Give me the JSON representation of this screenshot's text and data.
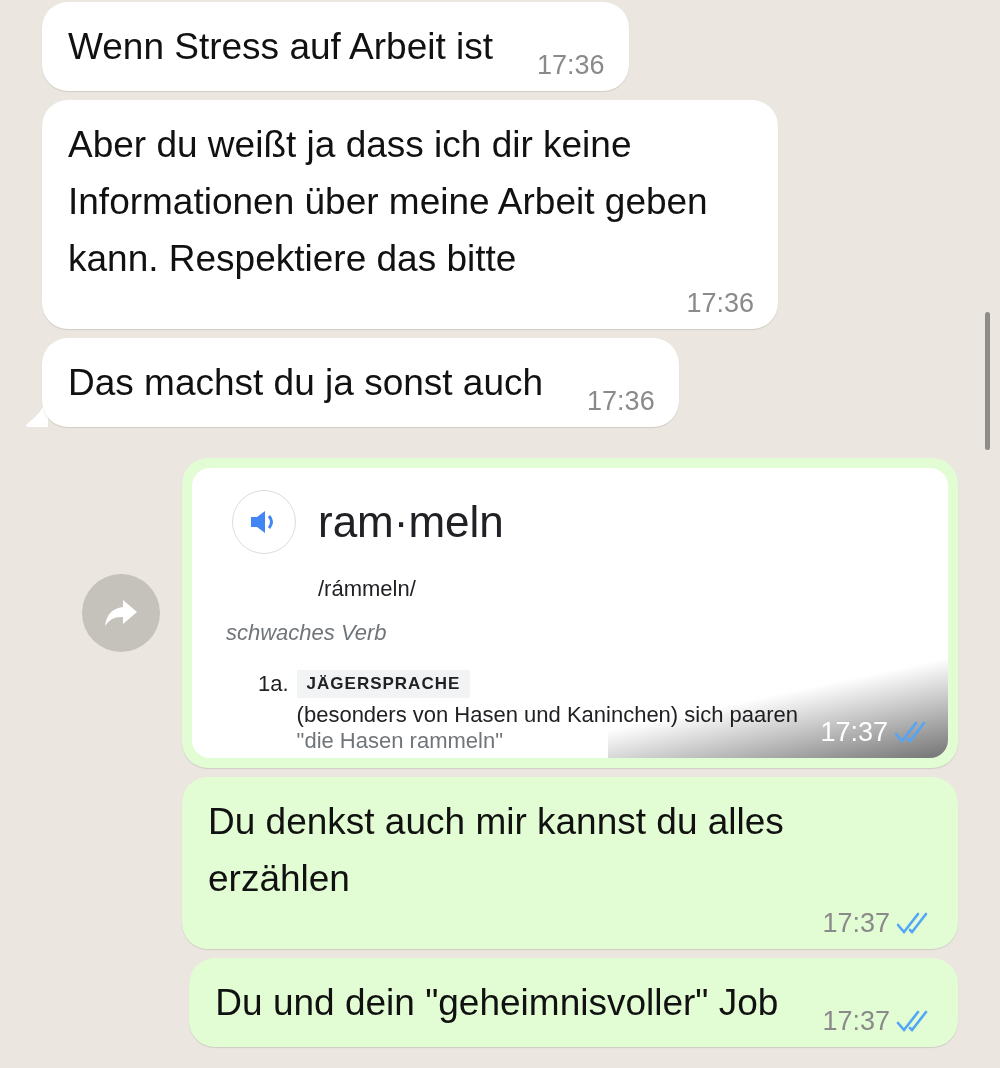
{
  "messages": [
    {
      "kind": "incoming",
      "text": "Wenn Stress auf Arbeit ist",
      "time": "17:36",
      "tail": false
    },
    {
      "kind": "incoming",
      "text": "Aber du weißt ja dass ich dir keine Informationen über meine Arbeit geben kann. Respektiere das bitte",
      "time": "17:36",
      "tail": false
    },
    {
      "kind": "incoming",
      "text": "Das machst du ja sonst auch",
      "time": "17:36",
      "tail": true
    },
    {
      "kind": "outgoing_image",
      "time": "17:37",
      "read": true,
      "forward": true,
      "screenshot": {
        "word": "ram·meln",
        "pronunciation": "/rámmeln/",
        "word_class": "schwaches Verb",
        "sense_number": "1a.",
        "tag": "JÄGERSPRACHE",
        "definition": "(besonders von Hasen und Kaninchen) sich paaren",
        "example": "\"die Hasen rammeln\""
      }
    },
    {
      "kind": "outgoing",
      "text": "Du denkst auch mir kannst du alles erzählen",
      "time": "17:37",
      "read": true
    },
    {
      "kind": "outgoing",
      "text": "Du und dein \"geheimnisvoller\" Job",
      "time": "17:37",
      "read": true
    }
  ]
}
